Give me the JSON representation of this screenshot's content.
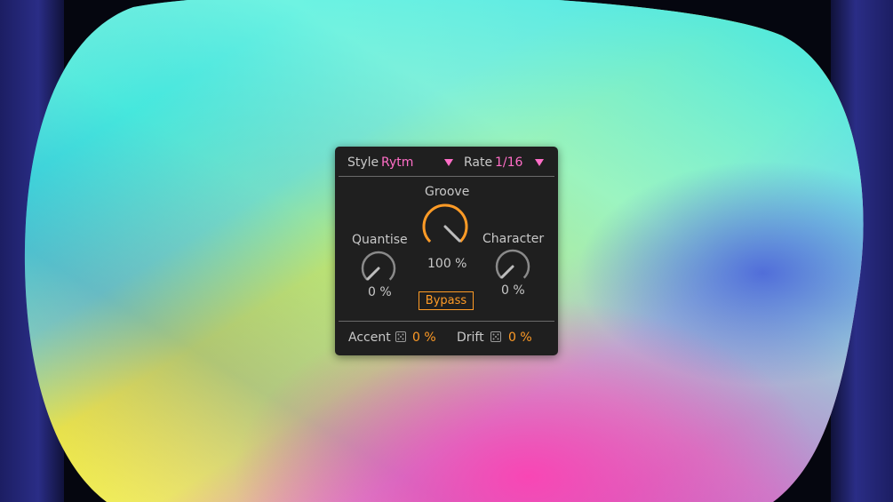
{
  "device": {
    "style_label": "Style",
    "style_value": "Rytm",
    "rate_label": "Rate",
    "rate_value": "1/16",
    "groove": {
      "label": "Groove",
      "value": "100 %",
      "level": 1.0
    },
    "quantise": {
      "label": "Quantise",
      "value": "0 %",
      "level": 0.0
    },
    "character": {
      "label": "Character",
      "value": "0 %",
      "level": 0.0
    },
    "bypass_label": "Bypass",
    "accent": {
      "label": "Accent",
      "value": "0 %",
      "icon": "dice-icon"
    },
    "drift": {
      "label": "Drift",
      "value": "0 %",
      "icon": "dice-icon"
    }
  },
  "colors": {
    "panel": "#1f1f1f",
    "text": "#c8c8c8",
    "pink_accent": "#ff6ec7",
    "orange_accent": "#ff9b26",
    "knob_track": "#8a8a8a"
  }
}
